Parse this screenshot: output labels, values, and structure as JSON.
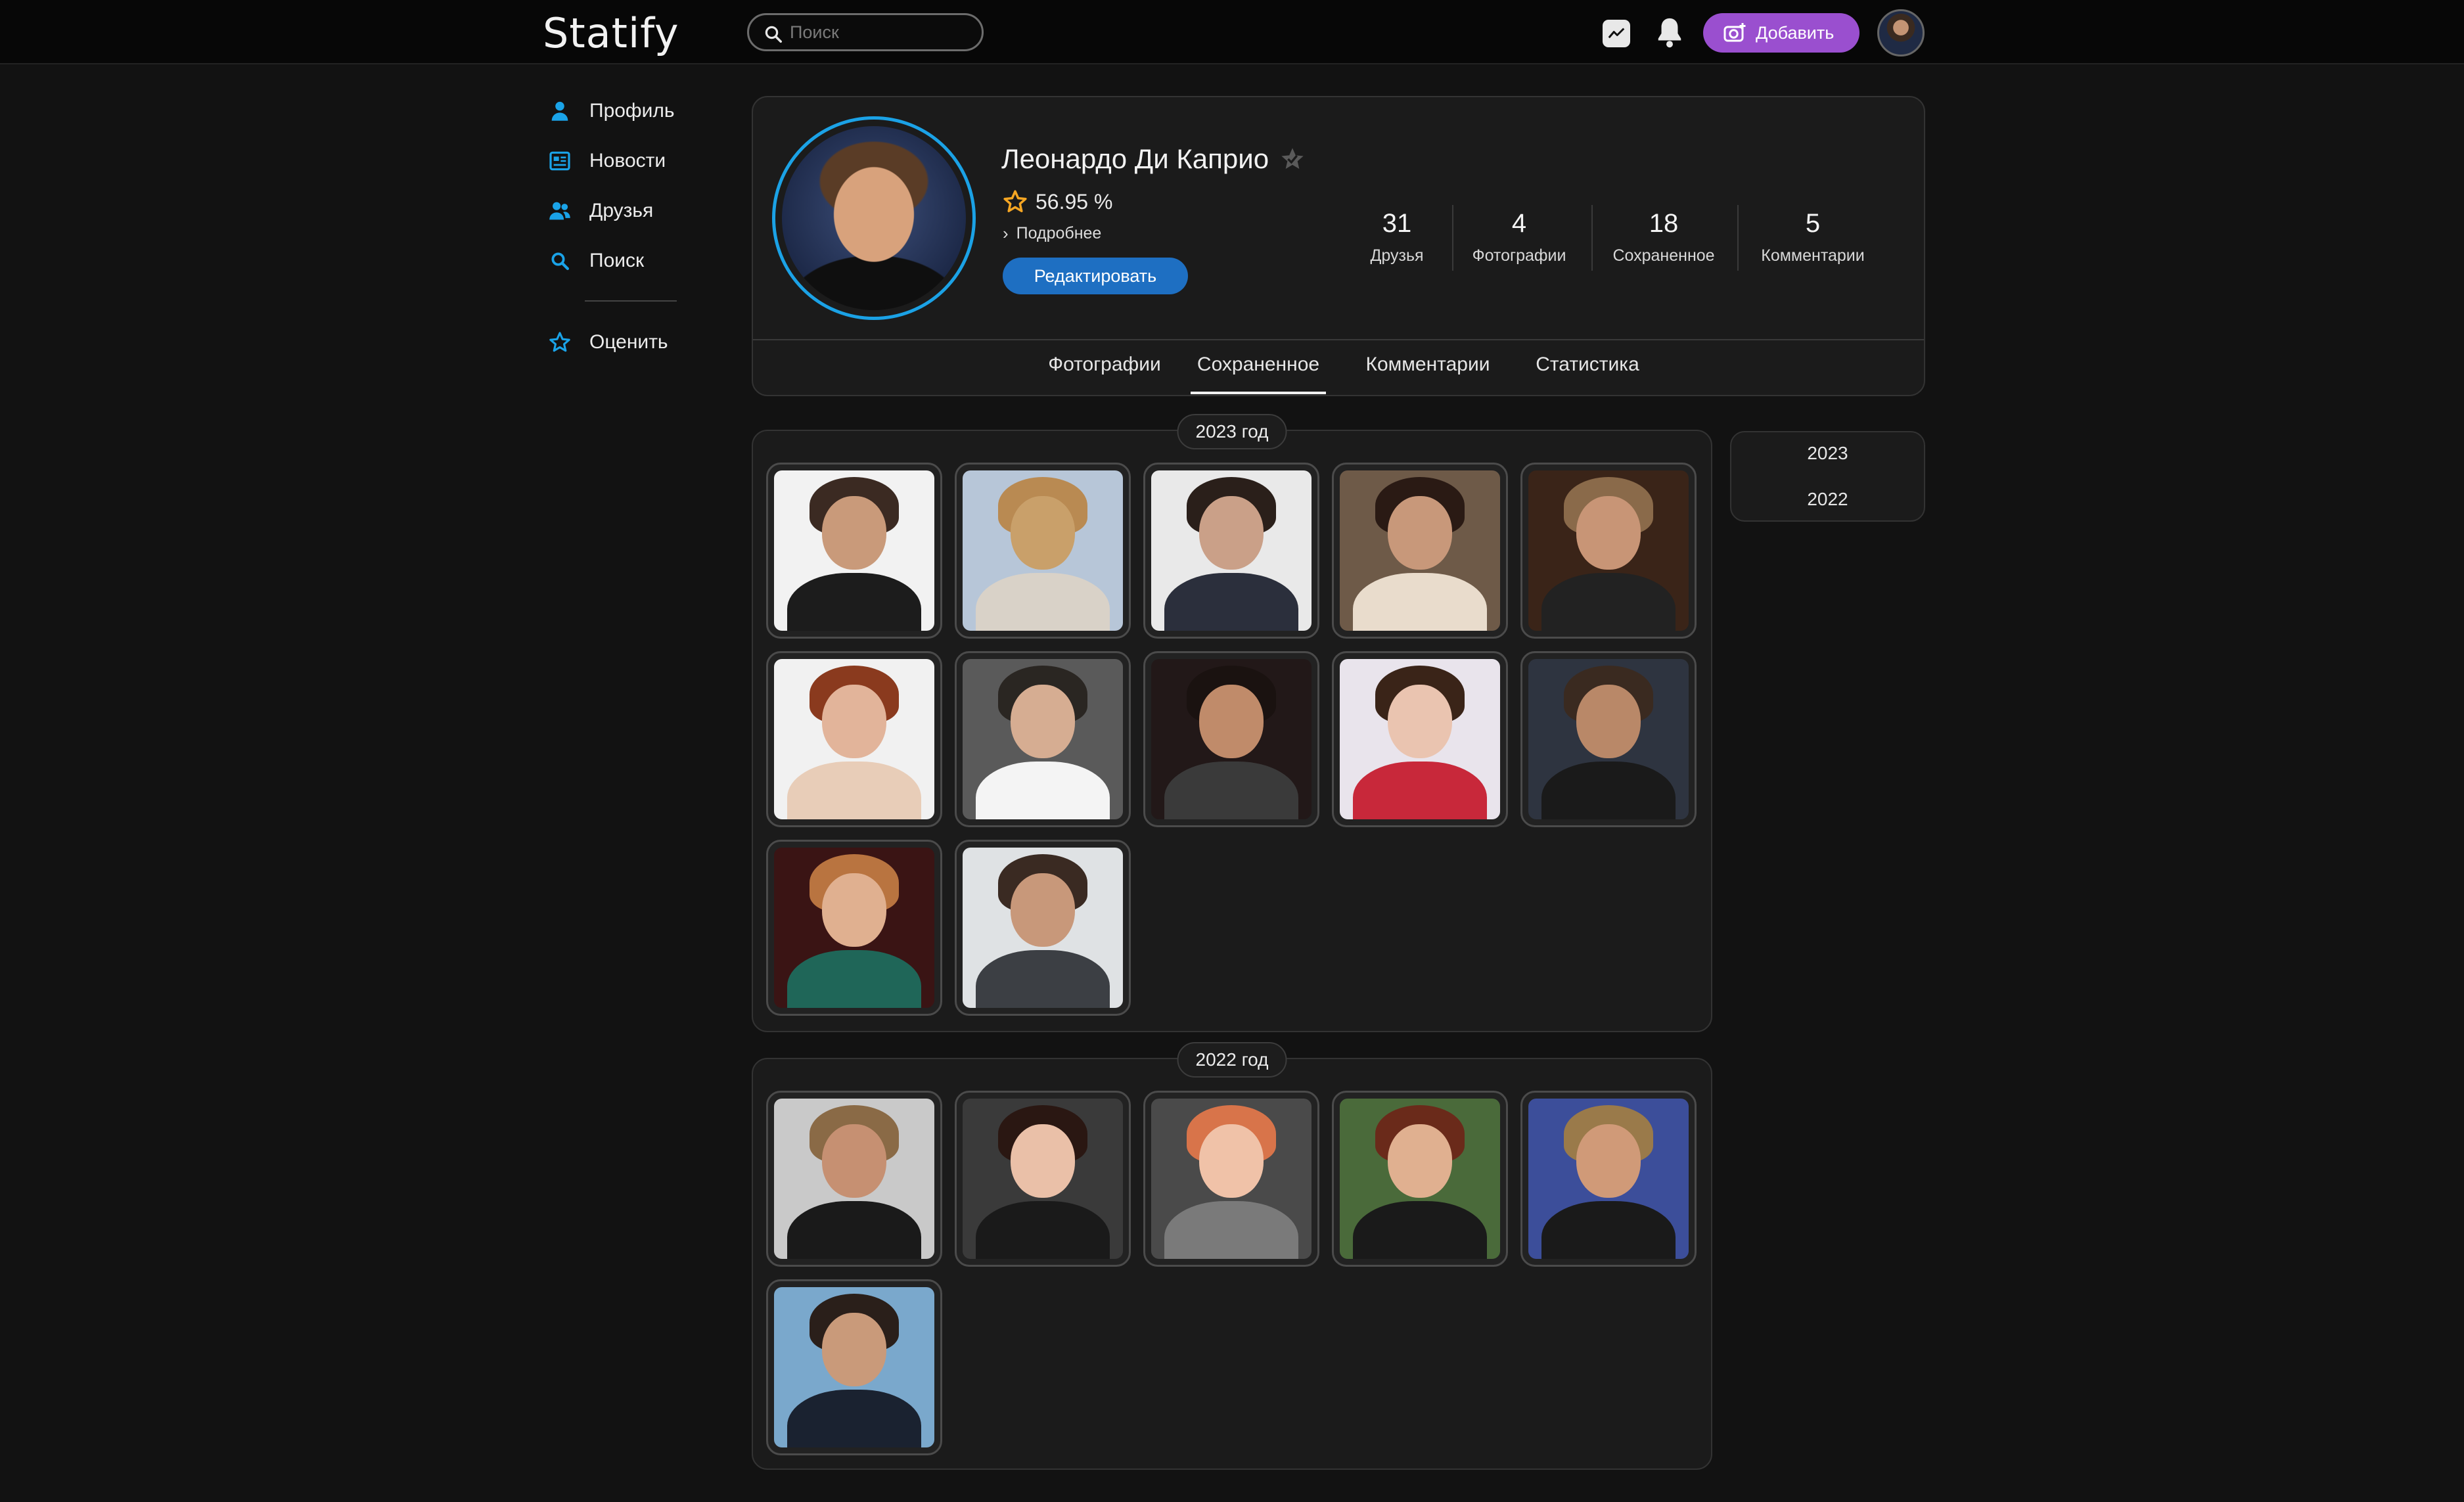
{
  "app": {
    "logo": "Statify"
  },
  "search": {
    "placeholder": "Поиск",
    "value": ""
  },
  "header": {
    "add_label": "Добавить"
  },
  "sidebar": {
    "items": [
      {
        "label": "Профиль",
        "icon": "user-icon"
      },
      {
        "label": "Новости",
        "icon": "news-icon"
      },
      {
        "label": "Друзья",
        "icon": "friends-icon"
      },
      {
        "label": "Поиск",
        "icon": "search-icon"
      },
      {
        "label": "Оценить",
        "icon": "star-icon"
      }
    ]
  },
  "profile": {
    "name": "Леонардо Ди Каприо",
    "rating": "56.95 %",
    "more_label": "Подробнее",
    "edit_label": "Редактировать",
    "stats": [
      {
        "value": "31",
        "label": "Друзья"
      },
      {
        "value": "4",
        "label": "Фотографии"
      },
      {
        "value": "18",
        "label": "Сохраненное"
      },
      {
        "value": "5",
        "label": "Комментарии"
      }
    ],
    "tabs": [
      "Фотографии",
      "Сохраненное",
      "Комментарии",
      "Статистика"
    ],
    "active_tab": "Сохраненное"
  },
  "sections": [
    {
      "year_label": "2023 год",
      "photo_count": 12
    },
    {
      "year_label": "2022 год",
      "photo_count": 6
    }
  ],
  "year_index": [
    "2023",
    "2022"
  ],
  "colors": {
    "background": "#121212",
    "accent_blue": "#1ba2e6",
    "edit_button": "#1e6fc2",
    "add_button": "#9a4fcf",
    "rating_star": "#f5a623"
  }
}
